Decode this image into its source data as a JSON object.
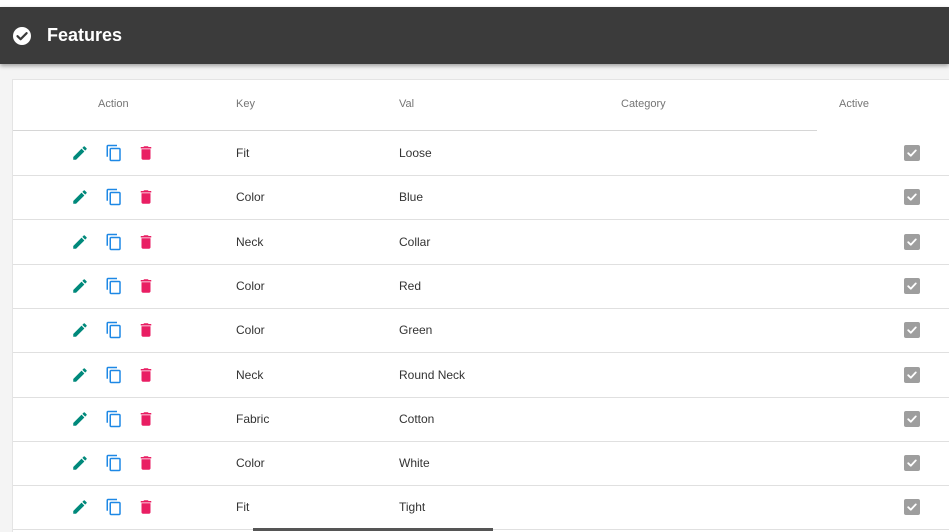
{
  "header": {
    "title": "Features"
  },
  "colors": {
    "edit": "#00897b",
    "copy": "#1e88e5",
    "delete": "#e91e63",
    "header_bg": "#3b3b3b",
    "checkbox": "#9e9e9e"
  },
  "table": {
    "columns": [
      "Action",
      "Key",
      "Val",
      "Category",
      "Active"
    ],
    "rows": [
      {
        "key": "Fit",
        "val": "Loose",
        "category": "",
        "active": true
      },
      {
        "key": "Color",
        "val": "Blue",
        "category": "",
        "active": true
      },
      {
        "key": "Neck",
        "val": "Collar",
        "category": "",
        "active": true
      },
      {
        "key": "Color",
        "val": "Red",
        "category": "",
        "active": true
      },
      {
        "key": "Color",
        "val": "Green",
        "category": "",
        "active": true
      },
      {
        "key": "Neck",
        "val": "Round Neck",
        "category": "",
        "active": true
      },
      {
        "key": "Fabric",
        "val": "Cotton",
        "category": "",
        "active": true
      },
      {
        "key": "Color",
        "val": "White",
        "category": "",
        "active": true
      },
      {
        "key": "Fit",
        "val": "Tight",
        "category": "",
        "active": true
      }
    ]
  },
  "icons": {
    "header": "check-circle-icon",
    "edit": "pencil-icon",
    "copy": "copy-icon",
    "delete": "trash-icon",
    "active": "checkbox-checked-icon"
  }
}
